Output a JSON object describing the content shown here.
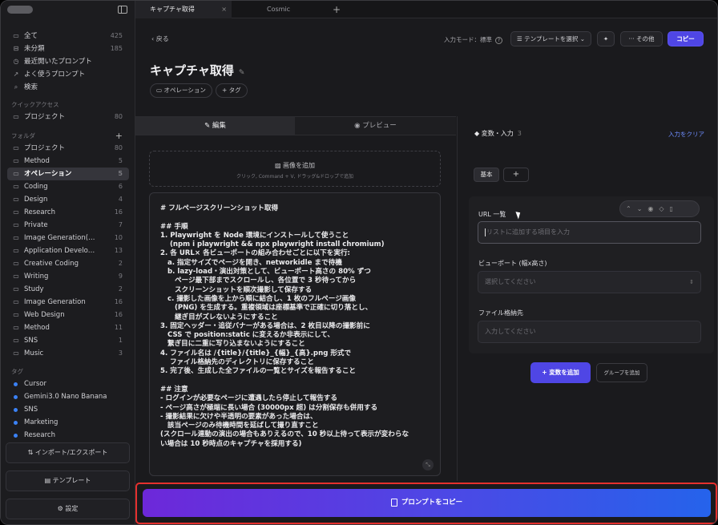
{
  "sidebar": {
    "main": [
      {
        "icon": "folder-icon",
        "glyph": "▭",
        "label": "全て",
        "count": "425"
      },
      {
        "icon": "inbox-icon",
        "glyph": "⊟",
        "label": "未分類",
        "count": "185"
      },
      {
        "icon": "clock-icon",
        "glyph": "◷",
        "label": "最近開いたプロンプト",
        "count": ""
      },
      {
        "icon": "frequent-icon",
        "glyph": "↗",
        "label": "よく使うプロンプト",
        "count": ""
      },
      {
        "icon": "search-icon",
        "glyph": "⌕",
        "label": "検索",
        "count": ""
      }
    ],
    "quick_label": "クイックアクセス",
    "quick": [
      {
        "label": "プロジェクト",
        "count": "80"
      }
    ],
    "folders_label": "フォルダ",
    "folders": [
      {
        "label": "プロジェクト",
        "count": "80"
      },
      {
        "label": "Method",
        "count": "5"
      },
      {
        "label": "オペレーション",
        "count": "5"
      },
      {
        "label": "Coding",
        "count": "6"
      },
      {
        "label": "Design",
        "count": "4"
      },
      {
        "label": "Research",
        "count": "16"
      },
      {
        "label": "Private",
        "count": "7"
      },
      {
        "label": "Image Generation(…",
        "count": "10"
      },
      {
        "label": "Application Develo…",
        "count": "13"
      },
      {
        "label": "Creative Coding",
        "count": "2"
      },
      {
        "label": "Writing",
        "count": "9"
      },
      {
        "label": "Study",
        "count": "2"
      },
      {
        "label": "Image Generation",
        "count": "16"
      },
      {
        "label": "Web Design",
        "count": "16"
      },
      {
        "label": "Method",
        "count": "11"
      },
      {
        "label": "SNS",
        "count": "1"
      },
      {
        "label": "Music",
        "count": "3"
      }
    ],
    "tags_label": "タグ",
    "tags": [
      "Cursor",
      "Gemini3.0 Nano Banana",
      "SNS",
      "Marketing",
      "Research"
    ],
    "import_export": "インポート/エクスポート",
    "templates": "テンプレート",
    "settings": "設定"
  },
  "tabs": [
    {
      "label": "キャプチャ取得",
      "close": "×"
    },
    {
      "label": "Cosmic"
    }
  ],
  "header": {
    "back": "戻る",
    "mode": "入力モード：標準",
    "template_select": "テンプレートを選択",
    "more": "その他",
    "copy": "コピー",
    "title": "キャプチャ取得",
    "chip_category": "オペレーション",
    "chip_tag": "+ タグ"
  },
  "editor": {
    "tab_edit": "編集",
    "tab_preview": "プレビュー",
    "add_image": "画像を追加",
    "add_image_hint": "クリック, Command + V, ドラッグ&ドロップで追加",
    "body": "# フルページスクリーンショット取得\n\n## 手順\n1. Playwright を Node 環境にインストールして使うこと\n    (npm i playwright && npx playwright install chromium)\n2. 各 URL× 各ビューポートの組み合わせごとに以下を実行:\n   a. 指定サイズでページを開き、networkidle まで待機\n   b. lazy-load・演出対策として、ビューポート高さの 80% ずつ\n      ページ最下部までスクロールし、各位置で 3 秒待ってから\n      スクリーンショットを順次撮影して保存する\n   c. 撮影した画像を上から順に結合し、1 枚のフルページ画像\n      (PNG) を生成する。重複領域は座標基準で正確に切り落とし、\n      継ぎ目がズレないようにすること\n3. 固定ヘッダー・追従バナーがある場合は、2 枚目以降の撮影前に\n   CSS で position:static に変えるか非表示にして、\n   繋ぎ目に二重に写り込まないようにすること\n4. ファイル名は /{title}/{title}_{幅}_{高}.png 形式で\n    ファイル格納先のディレクトリに保存すること\n5. 完了後、生成した全ファイルの一覧とサイズを報告すること\n\n## 注意\n- ログインが必要なページに遭遇したら停止して報告する\n- ページ高さが極端に長い場合 (30000px 超) は分割保存も併用する\n- 撮影結果に欠けや半透明の要素があった場合は、\n   該当ページのみ待機時間を延ばして撮り直すこと\n(スクロール連動の演出の場合もありえるので、10 秒以上待って表示が変わらな\nい場合は 10 秒時点のキャプチャを採用する)"
  },
  "variables": {
    "heading": "変数・入力",
    "count": "3",
    "clear": "入力をクリア",
    "tab_basic": "基本",
    "tab_add": "+",
    "fields": [
      {
        "label": "URL 一覧",
        "placeholder": "リストに追加する項目を入力",
        "kind": "text"
      },
      {
        "label": "ビューポート (幅x高さ)",
        "placeholder": "選択してください",
        "kind": "select"
      },
      {
        "label": "ファイル格納先",
        "placeholder": "入力してください",
        "kind": "text"
      }
    ],
    "add_variable": "+ 変数を追加",
    "add_group": "グループを追加"
  },
  "copy_prompt": "プロンプトをコピー"
}
